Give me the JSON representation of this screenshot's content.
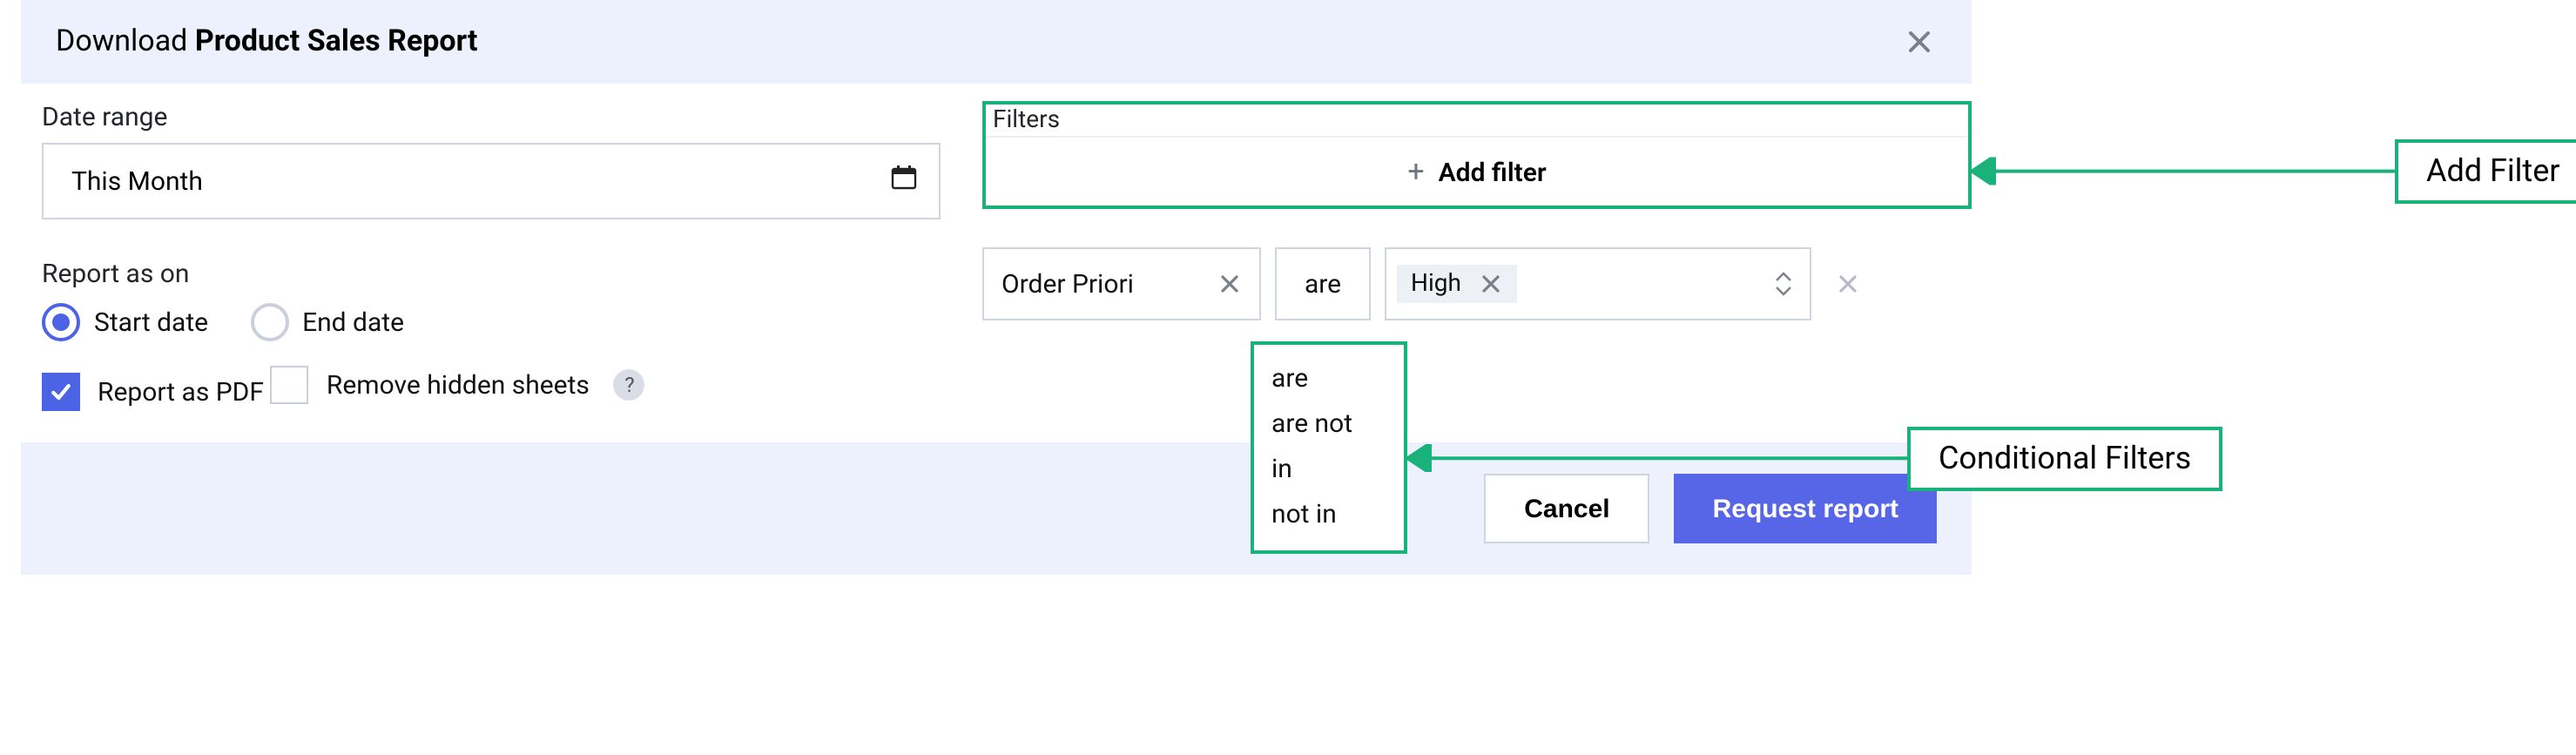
{
  "dialog": {
    "title_prefix": "Download ",
    "title_bold": "Product Sales Report"
  },
  "left": {
    "date_range_label": "Date range",
    "date_range_value": "This Month",
    "report_as_on_label": "Report as on",
    "radio_start": "Start date",
    "radio_end": "End date",
    "report_as_pdf": "Report as PDF",
    "remove_hidden": "Remove hidden sheets",
    "help_glyph": "?"
  },
  "right": {
    "filters_label": "Filters",
    "add_filter": "Add filter",
    "filter_row": {
      "field": "Order Priori",
      "op": "are",
      "value_chip": "High"
    },
    "op_options": [
      "are",
      "are not",
      "in",
      "not in"
    ]
  },
  "footer": {
    "cancel": "Cancel",
    "submit": "Request report"
  },
  "callouts": {
    "add_filter": "Add Filter",
    "conditional": "Conditional Filters"
  }
}
